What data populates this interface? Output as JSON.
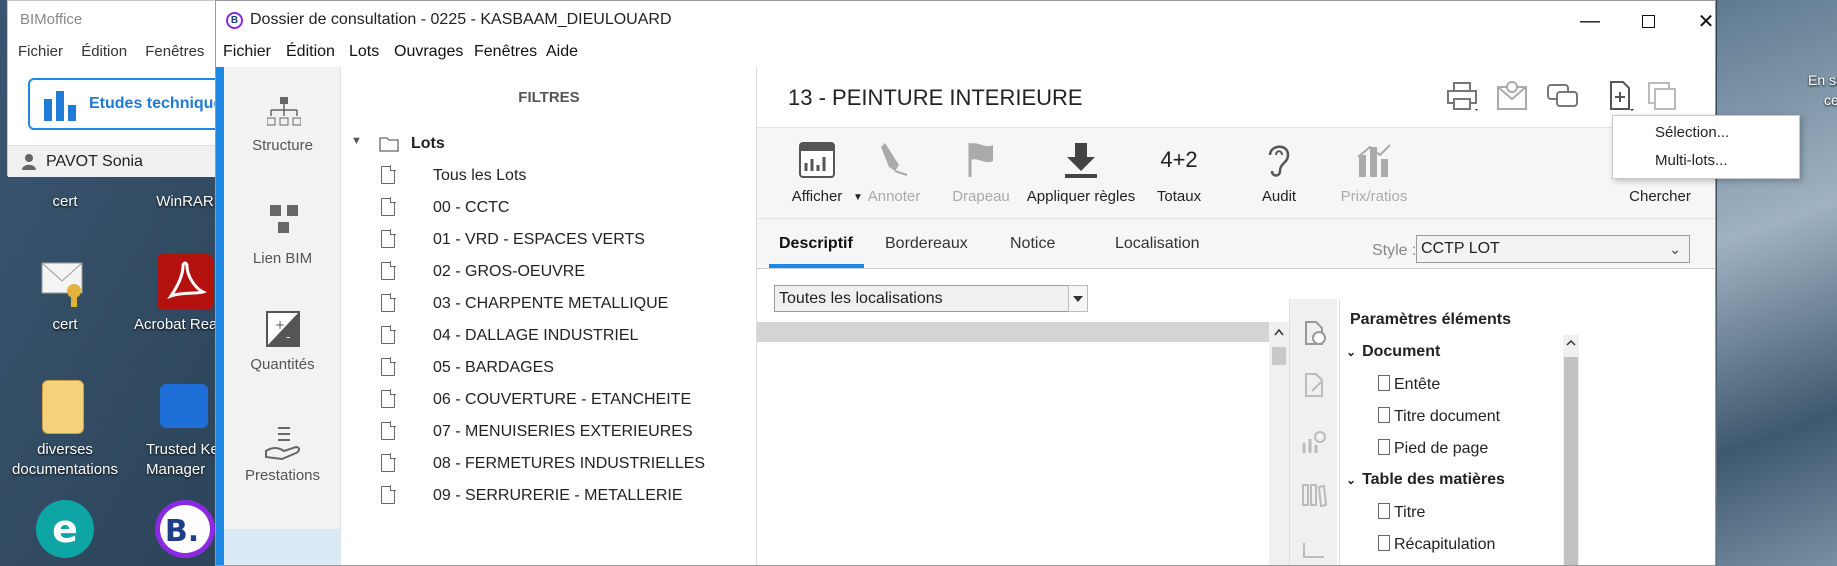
{
  "desktop": {
    "icons": [
      {
        "label": "cert"
      },
      {
        "label": "WinRAR"
      },
      {
        "label": "cert"
      },
      {
        "label": "Acrobat Rea"
      },
      {
        "label_line1": "diverses",
        "label_line2": "documentations"
      },
      {
        "label_line1": "Trusted Ke",
        "label_line2": "Manager"
      }
    ],
    "right_text_line1": "En sa",
    "right_text_line2": "ce"
  },
  "back_window": {
    "title": "BIMoffice",
    "menu": [
      "Fichier",
      "Édition",
      "Fenêtres"
    ],
    "button_label": "Etudes techniques",
    "user": "PAVOT Sonia"
  },
  "window": {
    "title": "Dossier de consultation - 0225 - KASBAAM_DIEULOUARD",
    "menu": [
      "Fichier",
      "Édition",
      "Lots",
      "Ouvrages",
      "Fenêtres",
      "Aide"
    ]
  },
  "sidenav": {
    "items": [
      "Structure",
      "Lien BIM",
      "Quantités",
      "Prestations"
    ]
  },
  "filters": {
    "title": "FILTRES",
    "root": "Lots",
    "items": [
      "Tous les Lots",
      "00 - CCTC",
      "01 - VRD - ESPACES VERTS",
      "02 - GROS-OEUVRE",
      "03 - CHARPENTE METALLIQUE",
      "04 - DALLAGE INDUSTRIEL",
      "05 - BARDAGES",
      "06 - COUVERTURE - ETANCHEITE",
      "07 - MENUISERIES EXTERIEURES",
      "08 - FERMETURES INDUSTRIELLES",
      "09 - SERRURERIE - METALLERIE"
    ]
  },
  "main": {
    "lot_title": "13 - PEINTURE INTERIEURE",
    "ribbon": {
      "afficher": "Afficher",
      "annoter": "Annoter",
      "drapeau": "Drapeau",
      "appliquer": "Appliquer règles",
      "totaux_icon": "4+2",
      "totaux": "Totaux",
      "audit": "Audit",
      "prix": "Prix/ratios",
      "chercher": "Chercher"
    },
    "tabs": [
      "Descriptif",
      "Bordereaux",
      "Notice",
      "Localisation"
    ],
    "style_label": "Style :",
    "style_value": "CCTP LOT",
    "localisation_value": "Toutes les localisations",
    "params": {
      "title": "Paramètres éléments",
      "sections": [
        {
          "label": "Document",
          "items": [
            "Entête",
            "Titre document",
            "Pied de page"
          ]
        },
        {
          "label": "Table des matières",
          "items": [
            "Titre",
            "Récapitulation"
          ]
        }
      ]
    }
  },
  "dropdown": {
    "items": [
      "Sélection...",
      "Multi-lots..."
    ]
  },
  "colors": {
    "accent": "#1e88e5",
    "nav_selected": "#dbe8f6"
  }
}
